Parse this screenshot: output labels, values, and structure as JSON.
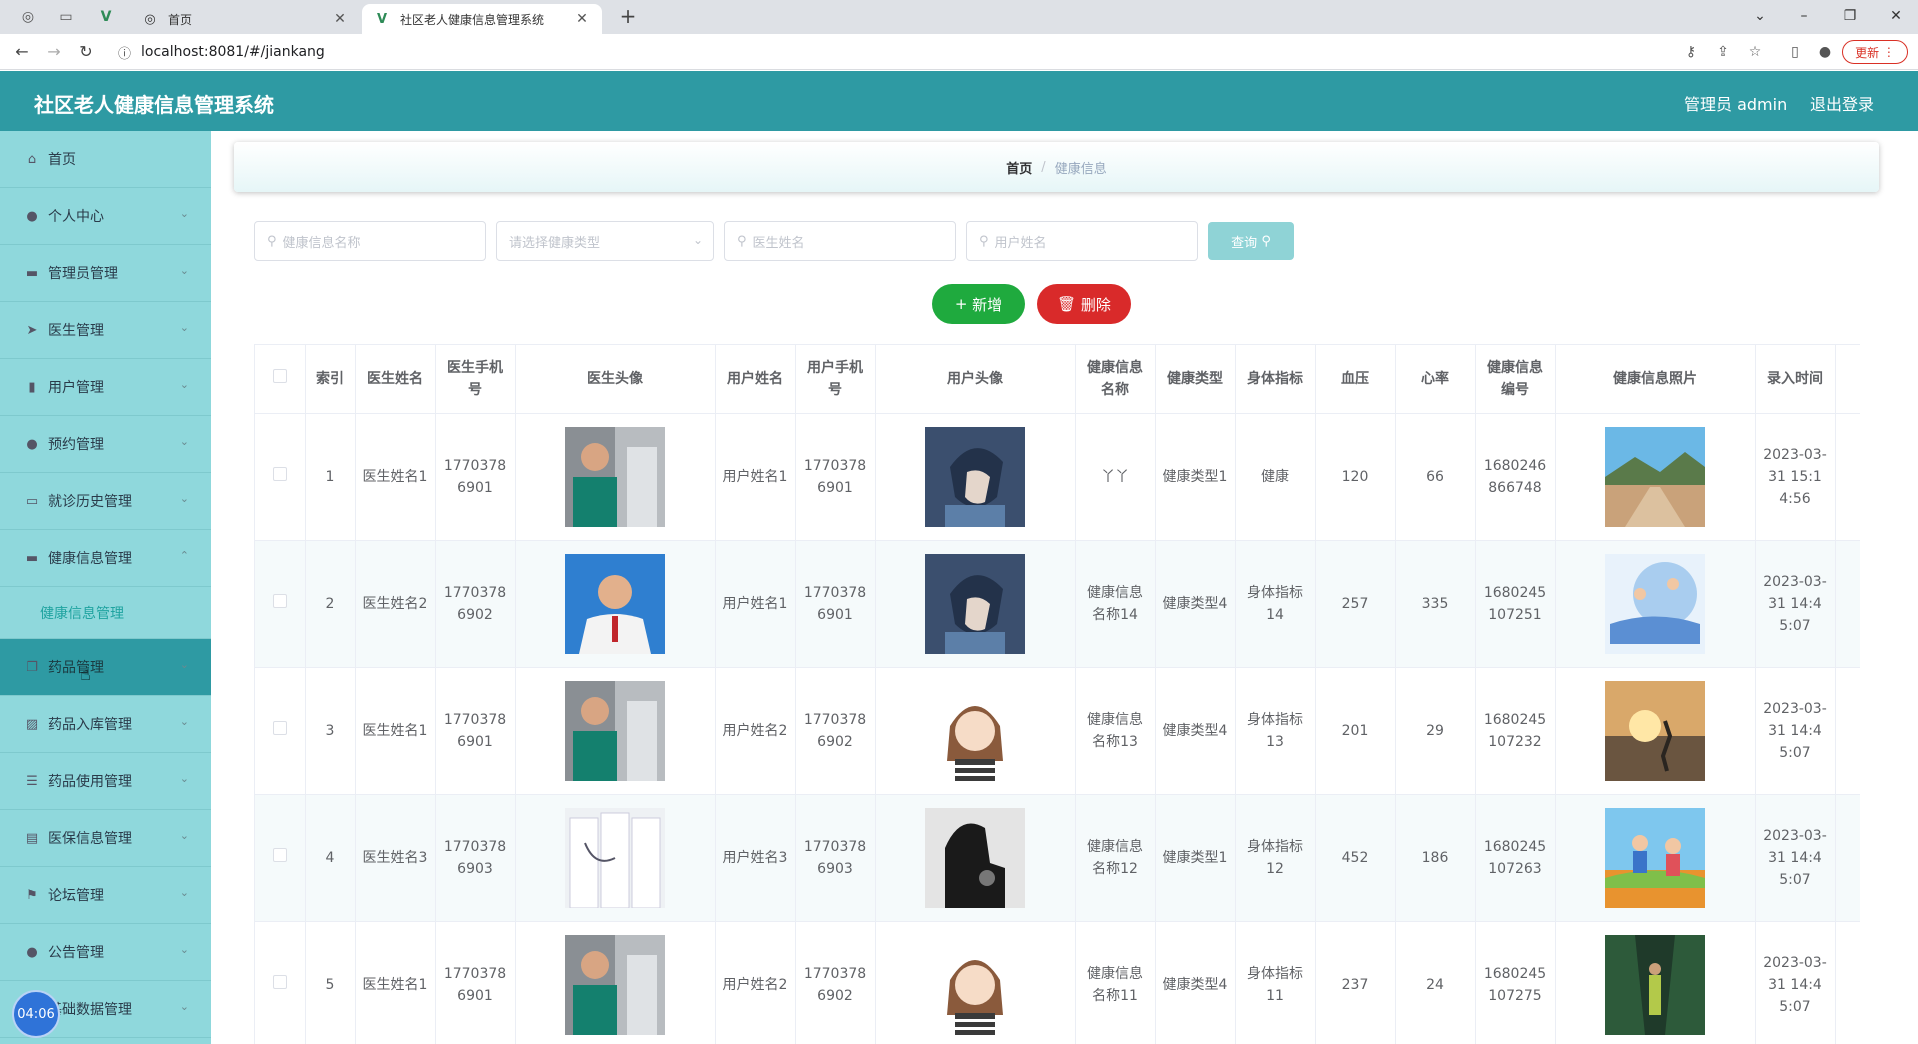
{
  "browser": {
    "inactive_tab_title": "首页",
    "active_tab_title": "社区老人健康信息管理系统",
    "url": "localhost:8081/#/jiankang",
    "update_label": "更新"
  },
  "header": {
    "title": "社区老人健康信息管理系统",
    "admin_label": "管理员 admin",
    "logout_label": "退出登录"
  },
  "sidebar": {
    "items": [
      {
        "label": "首页",
        "icon": "home-icon"
      },
      {
        "label": "个人中心",
        "icon": "user-icon"
      },
      {
        "label": "管理员管理",
        "icon": "briefcase-icon"
      },
      {
        "label": "医生管理",
        "icon": "send-icon"
      },
      {
        "label": "用户管理",
        "icon": "phone-icon"
      },
      {
        "label": "预约管理",
        "icon": "location-icon"
      },
      {
        "label": "就诊历史管理",
        "icon": "chat-icon"
      },
      {
        "label": "健康信息管理",
        "icon": "monitor-icon"
      },
      {
        "label": "健康信息管理",
        "icon": ""
      },
      {
        "label": "药品管理",
        "icon": "copy-icon"
      },
      {
        "label": "药品入库管理",
        "icon": "chart-icon"
      },
      {
        "label": "药品使用管理",
        "icon": "sliders-icon"
      },
      {
        "label": "医保信息管理",
        "icon": "notebook-icon"
      },
      {
        "label": "论坛管理",
        "icon": "flag-icon"
      },
      {
        "label": "公告管理",
        "icon": "user-icon"
      },
      {
        "label": "基础数据管理",
        "icon": "data-icon"
      }
    ],
    "clock": "04:06"
  },
  "breadcrumb": {
    "home": "首页",
    "separator": "/",
    "current": "健康信息"
  },
  "search": {
    "name_placeholder": "健康信息名称",
    "type_placeholder": "请选择健康类型",
    "doctor_placeholder": "医生姓名",
    "user_placeholder": "用户姓名",
    "query_label": "查询"
  },
  "actions": {
    "add_label": "新增",
    "delete_label": "删除"
  },
  "table": {
    "headers": [
      "索引",
      "医生姓名",
      "医生手机号",
      "医生头像",
      "用户姓名",
      "用户手机号",
      "用户头像",
      "健康信息名称",
      "健康类型",
      "身体指标",
      "血压",
      "心率",
      "健康信息编号",
      "健康信息照片",
      "录入时间"
    ],
    "rows": [
      {
        "index": "1",
        "doctor_name": "医生姓名1",
        "doctor_phone": "17703786901",
        "user_name": "用户姓名1",
        "user_phone": "17703786901",
        "info_name": "丫丫",
        "type": "健康类型1",
        "indicator": "健康",
        "bp": "120",
        "hr": "66",
        "code": "1680246866748",
        "time": "2023-03-31 15:14:56"
      },
      {
        "index": "2",
        "doctor_name": "医生姓名2",
        "doctor_phone": "17703786902",
        "user_name": "用户姓名1",
        "user_phone": "17703786901",
        "info_name": "健康信息名称14",
        "type": "健康类型4",
        "indicator": "身体指标14",
        "bp": "257",
        "hr": "335",
        "code": "1680245107251",
        "time": "2023-03-31 14:45:07"
      },
      {
        "index": "3",
        "doctor_name": "医生姓名1",
        "doctor_phone": "17703786901",
        "user_name": "用户姓名2",
        "user_phone": "17703786902",
        "info_name": "健康信息名称13",
        "type": "健康类型4",
        "indicator": "身体指标13",
        "bp": "201",
        "hr": "29",
        "code": "1680245107232",
        "time": "2023-03-31 14:45:07"
      },
      {
        "index": "4",
        "doctor_name": "医生姓名3",
        "doctor_phone": "17703786903",
        "user_name": "用户姓名3",
        "user_phone": "17703786903",
        "info_name": "健康信息名称12",
        "type": "健康类型1",
        "indicator": "身体指标12",
        "bp": "452",
        "hr": "186",
        "code": "1680245107263",
        "time": "2023-03-31 14:45:07"
      },
      {
        "index": "5",
        "doctor_name": "医生姓名1",
        "doctor_phone": "17703786901",
        "user_name": "用户姓名2",
        "user_phone": "17703786902",
        "info_name": "健康信息名称11",
        "type": "健康类型4",
        "indicator": "身体指标11",
        "bp": "237",
        "hr": "24",
        "code": "1680245107275",
        "time": "2023-03-31 14:45:07"
      }
    ]
  },
  "colors": {
    "header": "#2e9aa3",
    "sidebar": "#8fd8dc",
    "add_button": "#1faa3e",
    "delete_button": "#d92a2a",
    "query_button": "#8fd3d6"
  }
}
